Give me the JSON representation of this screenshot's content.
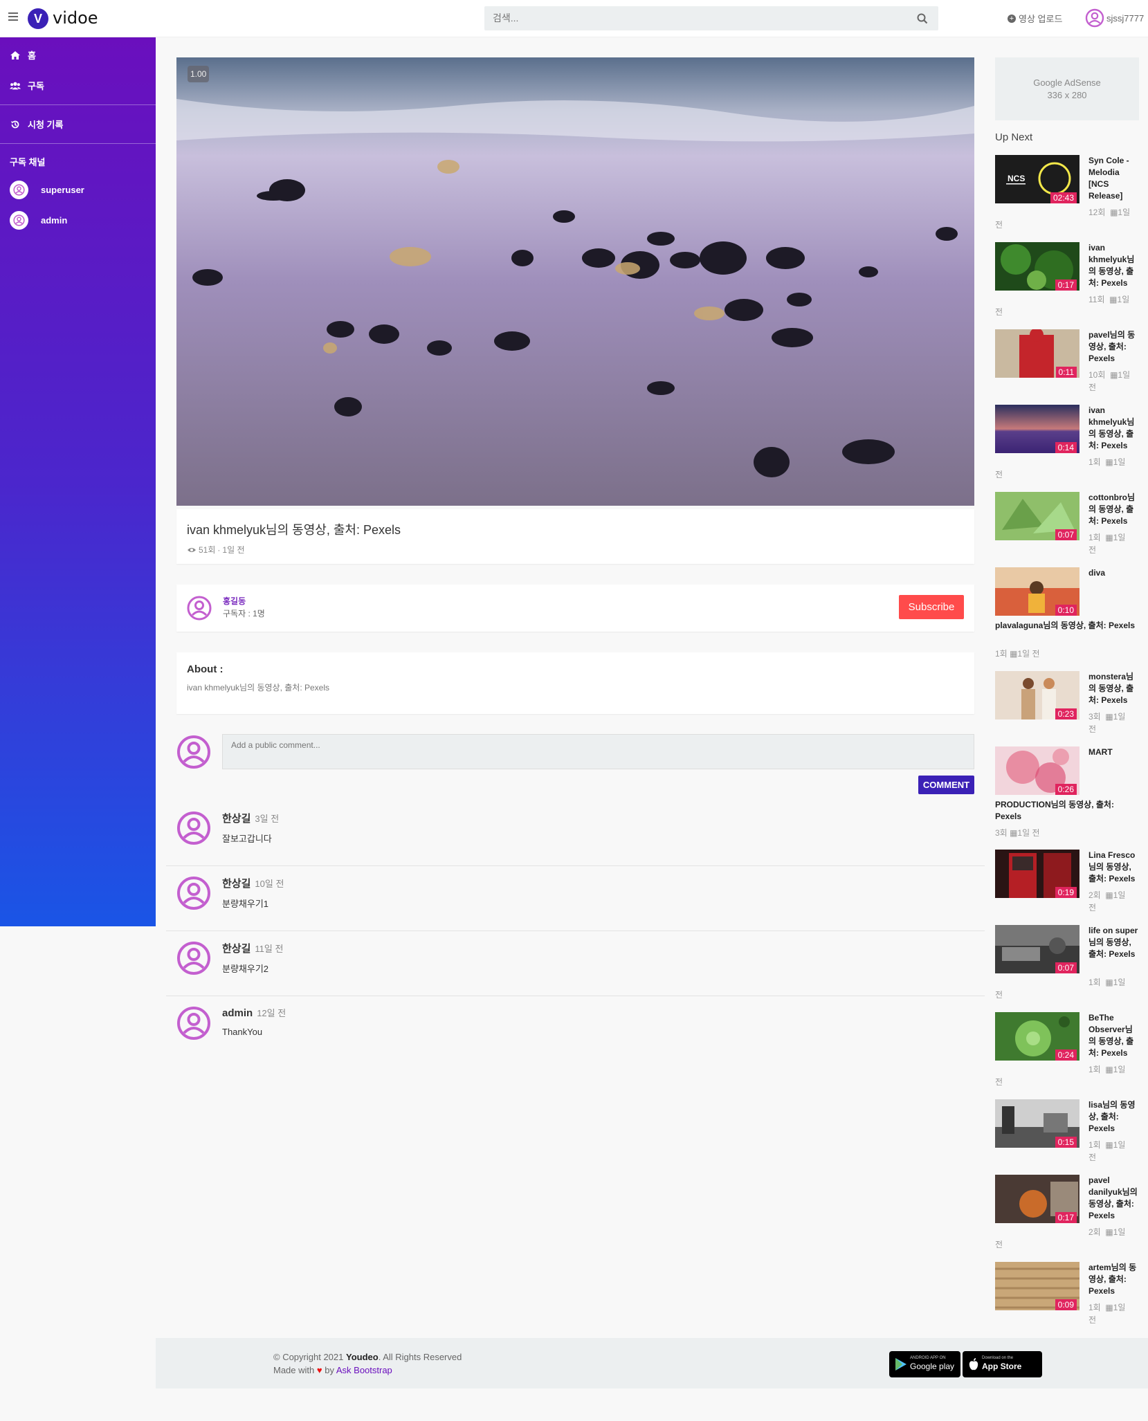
{
  "brand": {
    "logo_letter": "V",
    "name": "vidoe"
  },
  "search": {
    "placeholder": "검색..."
  },
  "topnav": {
    "upload_label": "영상 업로드",
    "username": "sjssj7777"
  },
  "sidebar": {
    "items": [
      {
        "icon": "home-icon",
        "label": "홈"
      },
      {
        "icon": "users-icon",
        "label": "구독"
      },
      {
        "icon": "history-icon",
        "label": "시청 기록"
      }
    ],
    "channels_heading": "구독 채널",
    "channels": [
      "superuser",
      "admin"
    ]
  },
  "player": {
    "speed": "1.00"
  },
  "video": {
    "title": "ivan khmelyuk님의 동영상, 출처: Pexels",
    "views": "51회",
    "separator": "·",
    "uploaded": "1일 전"
  },
  "channel": {
    "name": "홍길동",
    "subscribers": "구독자 : 1명",
    "subscribe_label": "Subscribe"
  },
  "about": {
    "label": "About :",
    "text": "ivan khmelyuk님의 동영상, 출처: Pexels"
  },
  "comment_form": {
    "placeholder": "Add a public comment...",
    "button": "COMMENT"
  },
  "comments": [
    {
      "author": "한상길",
      "time": "3일 전",
      "text": "잘보고갑니다"
    },
    {
      "author": "한상길",
      "time": "10일 전",
      "text": "분량채우기1"
    },
    {
      "author": "한상길",
      "time": "11일 전",
      "text": "분량채우기2"
    },
    {
      "author": "admin",
      "time": "12일 전",
      "text": "ThankYou"
    }
  ],
  "adsense": {
    "line1": "Google AdSense",
    "line2": "336 x 280"
  },
  "upnext": {
    "heading": "Up Next",
    "items": [
      {
        "title": "Syn Cole - Melodia [NCS Release]",
        "duration": "02:43",
        "views": "12회",
        "date": "1일",
        "suffix": "전"
      },
      {
        "title": "ivan khmelyuk님의 동영상, 출처: Pexels",
        "duration": "0:17",
        "views": "11회",
        "date": "1일",
        "suffix": "전"
      },
      {
        "title": "pavel님의 동영상, 출처: Pexels",
        "duration": "0:11",
        "views": "10회",
        "date": "1일",
        "suffix": "전"
      },
      {
        "title": "ivan khmelyuk님의 동영상, 출처: Pexels",
        "duration": "0:14",
        "views": "1회",
        "date": "1일",
        "suffix": "전"
      },
      {
        "title": "cottonbro님의 동영상, 출처: Pexels",
        "duration": "0:07",
        "views": "1회",
        "date": "1일",
        "suffix": "전"
      },
      {
        "title": "diva",
        "title2": "plavalaguna님의 동영상, 출처: Pexels",
        "duration": "0:10",
        "views": "1회",
        "date": "1일 전"
      },
      {
        "title": "monstera님의 동영상, 출처: Pexels",
        "duration": "0:23",
        "views": "3회",
        "date": "1일",
        "suffix": "전"
      },
      {
        "title": "MART",
        "title2": "PRODUCTION님의 동영상, 출처: Pexels",
        "duration": "0:26",
        "views": "3회",
        "date": "1일 전"
      },
      {
        "title": "Lina Fresco님의 동영상, 출처: Pexels",
        "duration": "0:19",
        "views": "2회",
        "date": "1일",
        "suffix": "전"
      },
      {
        "title": "life on super님의 동영상, 출처: Pexels",
        "duration": "0:07",
        "views": "1회",
        "date": "1일",
        "suffix": "전"
      },
      {
        "title": "BeThe Observer님의 동영상, 출처: Pexels",
        "duration": "0:24",
        "views": "1회",
        "date": "1일",
        "suffix": "전"
      },
      {
        "title": "lisa님의 동영상, 출처: Pexels",
        "duration": "0:15",
        "views": "1회",
        "date": "1일",
        "suffix": "전"
      },
      {
        "title": "pavel danilyuk님의 동영상, 출처: Pexels",
        "duration": "0:17",
        "views": "2회",
        "date": "1일",
        "suffix": "전"
      },
      {
        "title": "artem님의 동영상, 출처: Pexels",
        "duration": "0:09",
        "views": "1회",
        "date": "1일",
        "suffix": "전"
      }
    ]
  },
  "footer": {
    "copyright_prefix": "© Copyright 2021",
    "brand": "Youdeo",
    "rights": ". All Rights Reserved",
    "made_with": "Made with",
    "by": "by",
    "author_link": "Ask Bootstrap",
    "google_small": "ANDROID APP ON",
    "google_big": "Google play",
    "apple_small": "Download on the",
    "apple_big": "App Store"
  }
}
